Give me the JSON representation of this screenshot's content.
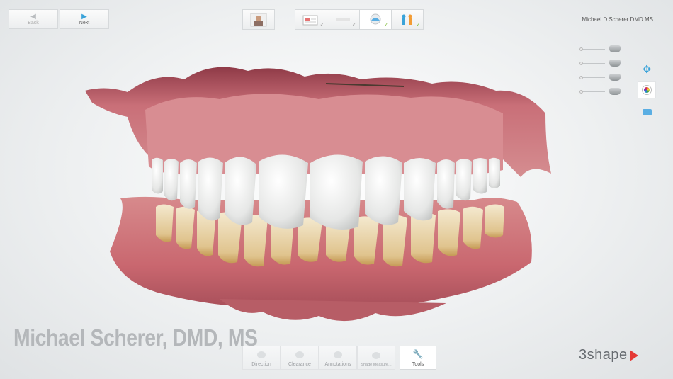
{
  "nav": {
    "back_label": "Back",
    "next_label": "Next"
  },
  "workflow_steps": [
    {
      "name": "profile",
      "label": ""
    },
    {
      "name": "prescription",
      "label": ""
    },
    {
      "name": "design",
      "label": ""
    },
    {
      "name": "review",
      "label": ""
    },
    {
      "name": "finish",
      "label": ""
    }
  ],
  "user": {
    "name": "Michael D Scherer DMD MS"
  },
  "bottom_tools": {
    "direction": "Direction",
    "clearance": "Clearance",
    "annotations": "Annotations",
    "shade_measure": "Shade Measure...",
    "tools": "Tools"
  },
  "watermark": {
    "text": "Michael Scherer, DMD, MS"
  },
  "brand": {
    "name": "3shape"
  },
  "icons": {
    "back": "arrow-left-icon",
    "next": "arrow-right-icon",
    "move": "move-icon",
    "color": "color-wheel-icon",
    "view": "view-mode-icon",
    "tools": "wrench-icon"
  },
  "colors": {
    "accent": "#3aa3d9",
    "check": "#8bc34a",
    "brand_mark": "#e53935"
  }
}
